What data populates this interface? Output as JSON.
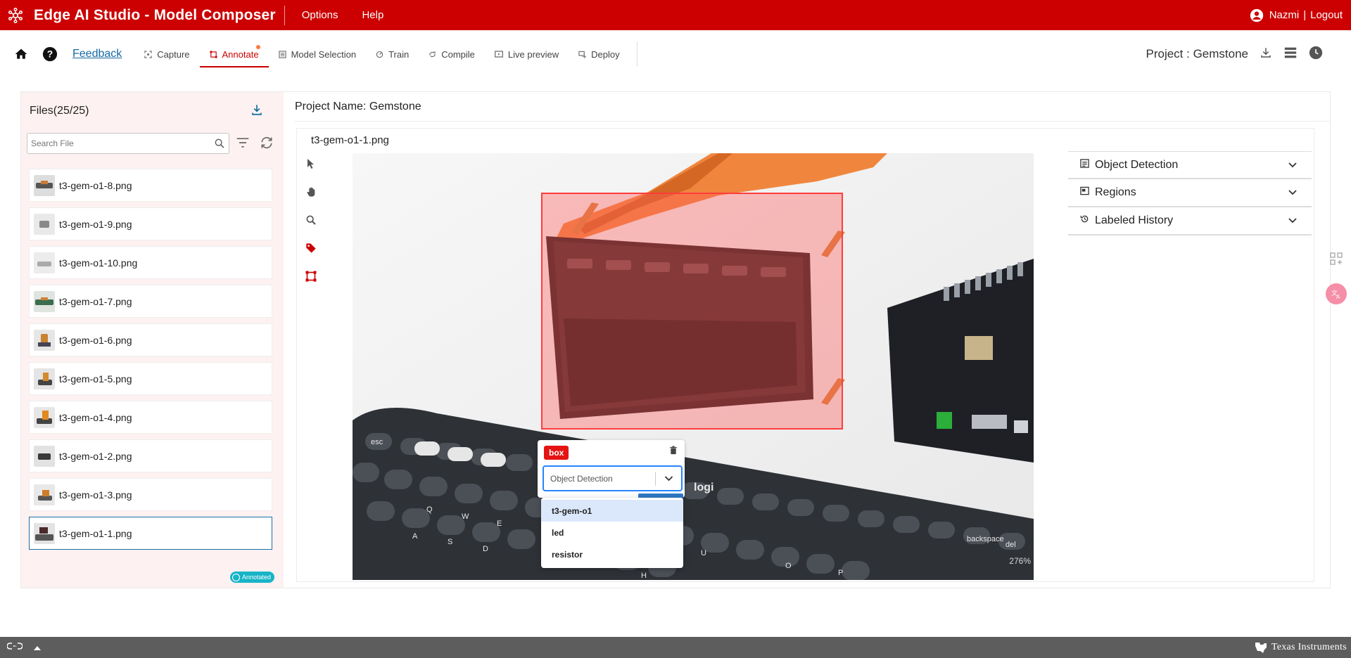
{
  "app": {
    "title": "Edge AI Studio - Model Composer",
    "menu": [
      "Options",
      "Help"
    ],
    "user": {
      "name": "Nazmi",
      "separator": "|",
      "logout": "Logout"
    }
  },
  "toolbar": {
    "feedback": "Feedback",
    "tabs": [
      {
        "label": "Capture",
        "icon": "capture-icon"
      },
      {
        "label": "Annotate",
        "icon": "annotate-icon",
        "active": true
      },
      {
        "label": "Model Selection",
        "icon": "model-selection-icon"
      },
      {
        "label": "Train",
        "icon": "train-icon"
      },
      {
        "label": "Compile",
        "icon": "compile-icon"
      },
      {
        "label": "Live preview",
        "icon": "live-preview-icon"
      },
      {
        "label": "Deploy",
        "icon": "deploy-icon"
      }
    ],
    "project_label": "Project : Gemstone"
  },
  "files": {
    "header": "Files(25/25)",
    "search_placeholder": "Search File",
    "items": [
      {
        "name": "t3-gem-o1-8.png"
      },
      {
        "name": "t3-gem-o1-9.png"
      },
      {
        "name": "t3-gem-o1-10.png"
      },
      {
        "name": "t3-gem-o1-7.png"
      },
      {
        "name": "t3-gem-o1-6.png"
      },
      {
        "name": "t3-gem-o1-5.png"
      },
      {
        "name": "t3-gem-o1-4.png"
      },
      {
        "name": "t3-gem-o1-2.png"
      },
      {
        "name": "t3-gem-o1-3.png"
      },
      {
        "name": "t3-gem-o1-1.png",
        "selected": true
      }
    ],
    "annotated_badge": "Annotated"
  },
  "canvas": {
    "project_name": "Project Name: Gemstone",
    "image_name": "t3-gem-o1-1.png",
    "zoom": "276%",
    "keyboard_keys": [
      "esc",
      "logi",
      "backspace",
      "del",
      "W",
      "E",
      "S",
      "D",
      "A",
      "Q",
      "U",
      "O",
      "P",
      "H"
    ]
  },
  "annotation": {
    "tag": "box",
    "type_value": "Object Detection",
    "options": [
      "t3-gem-o1",
      "led",
      "resistor"
    ],
    "highlighted": "t3-gem-o1"
  },
  "panels": {
    "object_detection": "Object Detection",
    "regions": "Regions",
    "labeled_history": "Labeled History"
  },
  "footer": {
    "brand": "Texas Instruments"
  },
  "colors": {
    "brand_red": "#cc0000",
    "link_blue": "#1569a3",
    "teal": "#17b4c7",
    "bbox_red": "#ff3c3c",
    "focus_blue": "#2684ff"
  }
}
